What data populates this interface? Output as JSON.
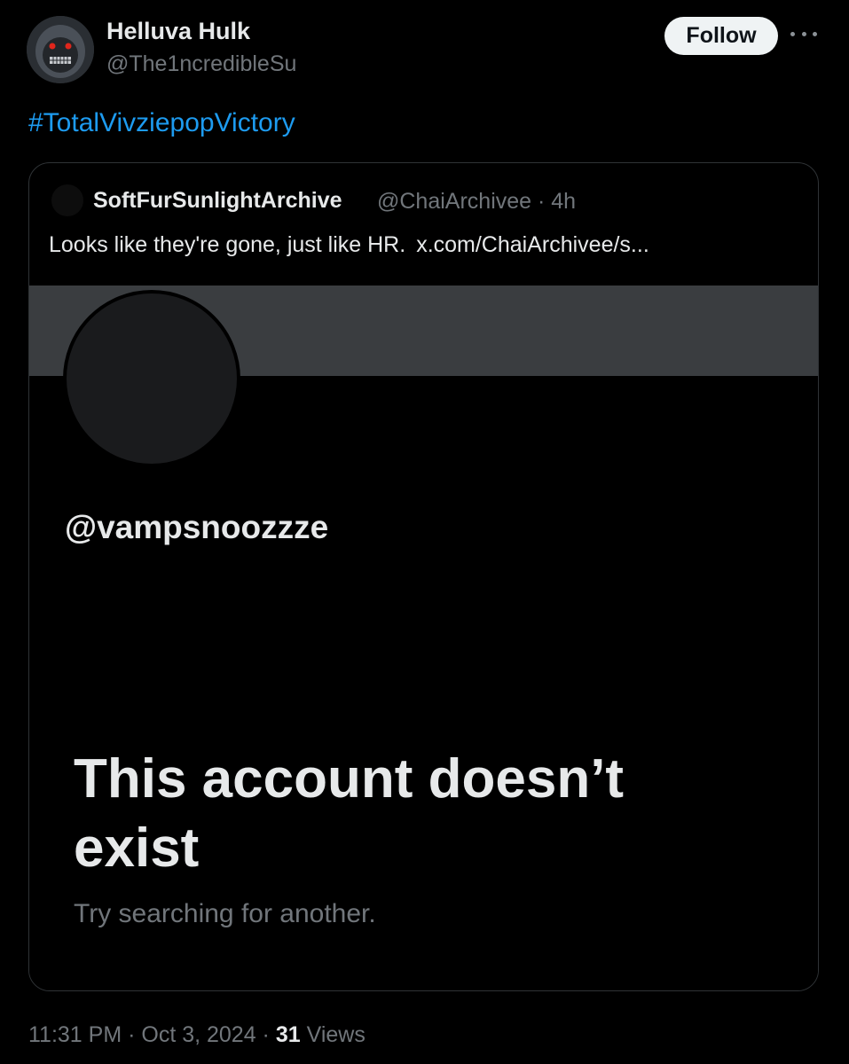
{
  "tweet": {
    "author": {
      "name": "Helluva Hulk",
      "handle": "@The1ncredibleSu"
    },
    "follow_label": "Follow",
    "text": "#TotalVivziepopVictory",
    "timestamp": "11:31 PM · Oct 3, 2024 ·",
    "views_count": "31",
    "views_label": "Views"
  },
  "quote": {
    "author_name": "SoftFurSunlightArchive",
    "handle_time": "@ChaiArchivee · 4h",
    "text": "Looks like they're gone, just like HR.",
    "link": "x.com/ChaiArchivee/s...",
    "embed": {
      "handle": "@vampsnoozzze",
      "title": "This account doesn’t exist",
      "subtitle": "Try searching for another."
    }
  },
  "colors": {
    "background": "#000000",
    "primary_text": "#e7e9ea",
    "secondary_text": "#71767b",
    "link": "#1d9bf0",
    "follow_button": "#eff3f4"
  },
  "icons": {
    "more": "more-horizontal-icon"
  }
}
